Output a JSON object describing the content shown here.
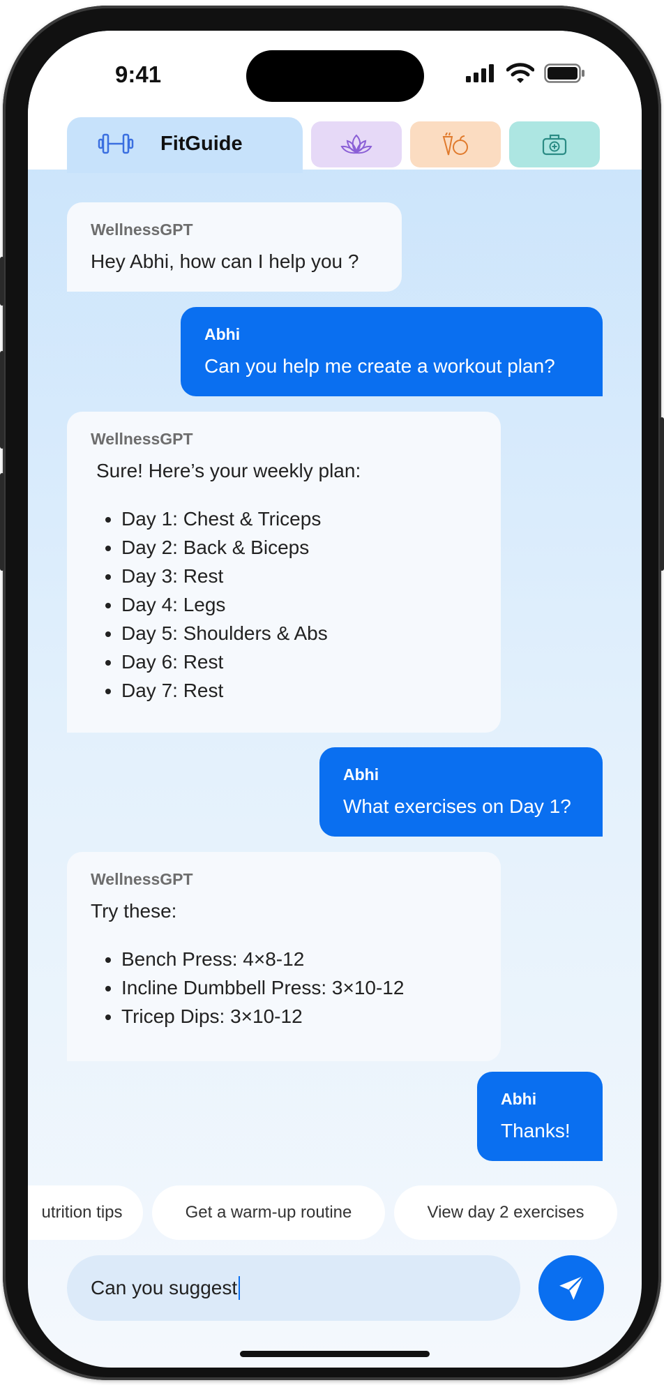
{
  "status": {
    "time": "9:41"
  },
  "tabs": {
    "active": {
      "label": "FitGuide",
      "icon": "dumbbell-icon"
    },
    "others": [
      {
        "icon": "lotus-icon",
        "color": "#e6d9f7"
      },
      {
        "icon": "carrot-apple-icon",
        "color": "#fbdcc1"
      },
      {
        "icon": "first-aid-kit-icon",
        "color": "#ade6e2"
      }
    ]
  },
  "messages": [
    {
      "sender": "WellnessGPT",
      "text": "Hey Abhi, how can I help you ?"
    },
    {
      "sender": "Abhi",
      "text": "Can you help me create a workout plan?"
    },
    {
      "sender": "WellnessGPT",
      "text": "Sure! Here’s your weekly plan:",
      "items": [
        "Day 1: Chest & Triceps",
        "Day 2: Back & Biceps",
        "Day 3: Rest",
        "Day 4: Legs",
        "Day 5: Shoulders & Abs",
        "Day 6: Rest",
        "Day 7: Rest"
      ]
    },
    {
      "sender": "Abhi",
      "text": "What exercises on Day 1?"
    },
    {
      "sender": "WellnessGPT",
      "text": "Try these:",
      "items": [
        "Bench Press: 4×8-12",
        "Incline Dumbbell Press: 3×10-12",
        "Tricep Dips: 3×10-12"
      ]
    },
    {
      "sender": "Abhi",
      "text": "Thanks!"
    }
  ],
  "suggestions": [
    "utrition tips",
    "Get a warm-up routine",
    "View day 2 exercises"
  ],
  "composer": {
    "value": "Can you suggest"
  },
  "colors": {
    "accent": "#0a6ff0",
    "bot_bubble": "#f6f9fd"
  }
}
